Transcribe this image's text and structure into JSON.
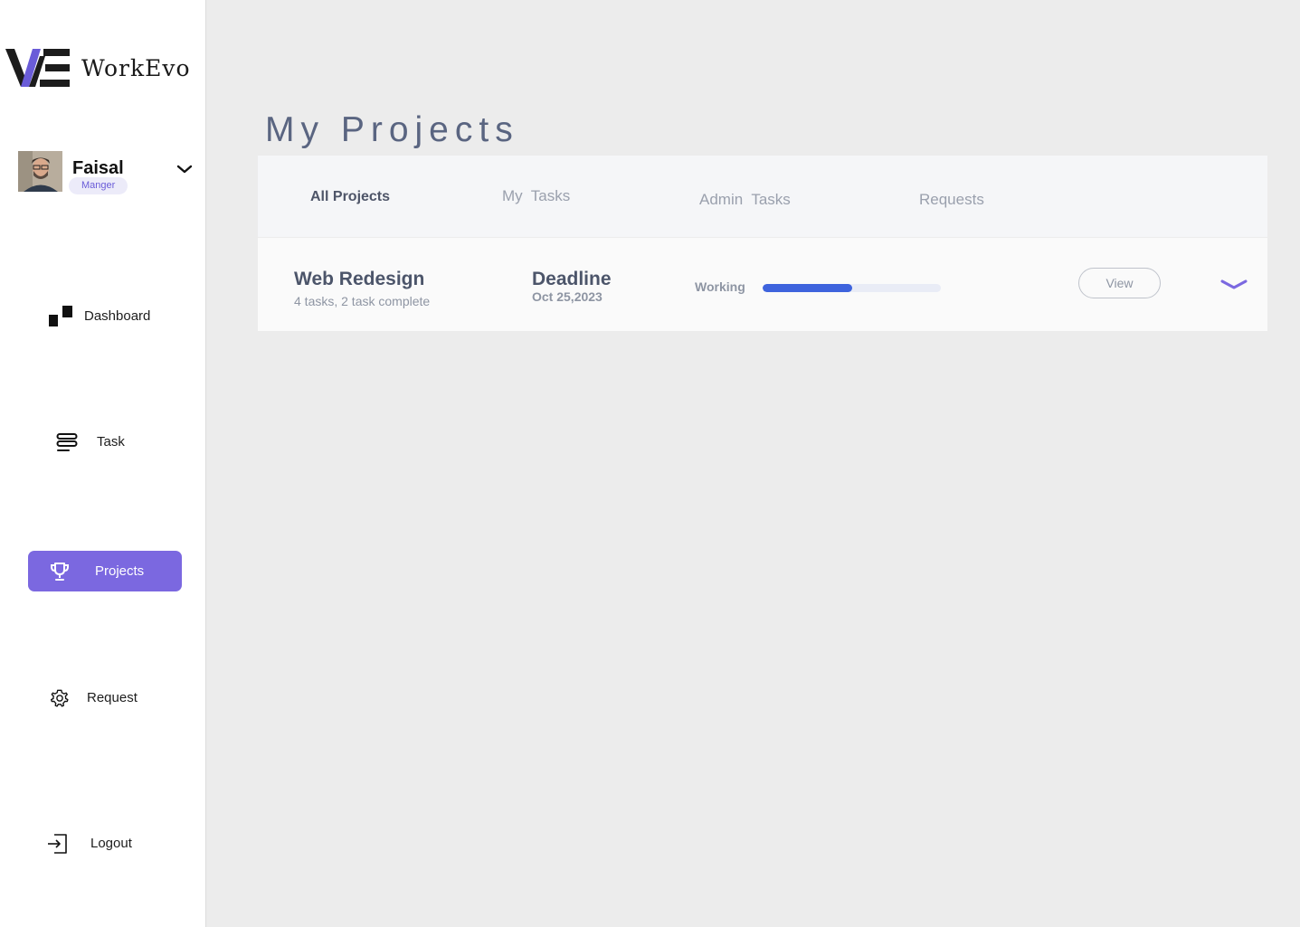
{
  "brand": {
    "name": "WorkEvo",
    "logo_colors": [
      "#1c1c1c",
      "#6a5cd8"
    ]
  },
  "user": {
    "name": "Faisal",
    "role": "Manger",
    "menu_icon": "chevron-down-icon"
  },
  "sidebar": {
    "items": [
      {
        "label": "Dashboard",
        "icon": "dashboard-icon",
        "active": false
      },
      {
        "label": "Task",
        "icon": "task-list-icon",
        "active": false
      },
      {
        "label": "Projects",
        "icon": "trophy-icon",
        "active": true
      },
      {
        "label": "Request",
        "icon": "gear-icon",
        "active": false
      },
      {
        "label": "Logout",
        "icon": "logout-icon",
        "active": false
      }
    ]
  },
  "main": {
    "title": "My Projects",
    "tabs": [
      {
        "label": "All Projects",
        "active": true
      },
      {
        "label": "My  Tasks",
        "active": false
      },
      {
        "label": "Admin  Tasks",
        "active": false
      },
      {
        "label": "Requests",
        "active": false
      }
    ],
    "projects": [
      {
        "name": "Web Redesign",
        "summary": "4 tasks, 2 task complete",
        "deadline_label": "Deadline",
        "deadline": "Oct 25,2023",
        "status": "Working",
        "progress": 0.5,
        "view_label": "View"
      }
    ]
  },
  "colors": {
    "accent": "#7b68e0",
    "progress": "#3e63dd",
    "title": "#5a6581"
  }
}
